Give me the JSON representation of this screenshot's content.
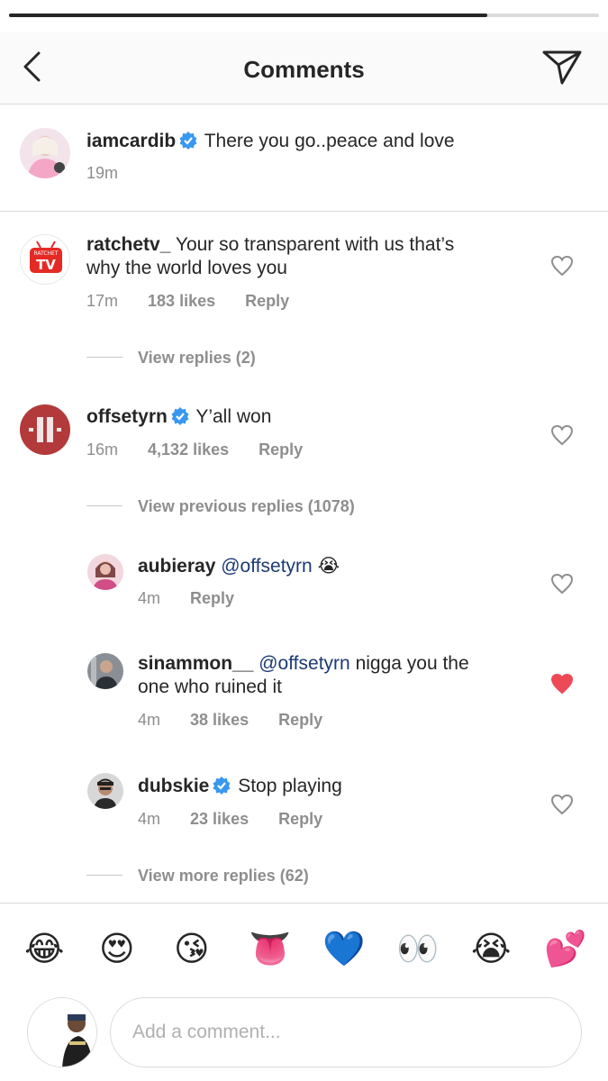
{
  "progress": {
    "fraction": 0.81
  },
  "header": {
    "title": "Comments",
    "back_icon": "chevron-left-icon",
    "share_icon": "paper-plane-icon"
  },
  "caption": {
    "username": "iamcardib",
    "verified": true,
    "text": "There you go..peace and love",
    "time": "19m"
  },
  "comments": [
    {
      "username": "ratchetv_",
      "verified": false,
      "text_line1": "Your so transparent with us that’s",
      "text_line2": "why the world loves you",
      "time": "17m",
      "likes": "183 likes",
      "reply": "Reply",
      "liked": false,
      "view_replies": "View replies (2)"
    },
    {
      "username": "offsetyrn",
      "verified": true,
      "text": "Y’all won",
      "time": "16m",
      "likes": "4,132 likes",
      "reply": "Reply",
      "liked": false,
      "view_replies": "View previous replies (1078)"
    }
  ],
  "replies": [
    {
      "username": "aubieray",
      "mention": "@offsetyrn",
      "text": "😭",
      "time": "4m",
      "reply": "Reply",
      "liked": false
    },
    {
      "username": "sinammon__",
      "mention": "@offsetyrn",
      "text_line1": "nigga you the",
      "text_line2": "one who ruined it",
      "time": "4m",
      "likes": "38 likes",
      "reply": "Reply",
      "liked": true
    },
    {
      "username": "dubskie",
      "verified": true,
      "text": "Stop playing",
      "time": "4m",
      "likes": "23 likes",
      "reply": "Reply",
      "liked": false
    }
  ],
  "view_more_replies": "View more replies (62)",
  "ratchet_logo": {
    "top": "RATCHET",
    "bottom": "TV"
  },
  "emojis": [
    "😂",
    "😍",
    "😘",
    "👅",
    "💙",
    "👀",
    "😭",
    "💕"
  ],
  "composer": {
    "placeholder": "Add a comment..."
  },
  "colors": {
    "liked_heart": "#ed4956",
    "verified_blue": "#3897f0",
    "meta_gray": "#8e8e8e",
    "mention_blue": "#1c3a73"
  }
}
